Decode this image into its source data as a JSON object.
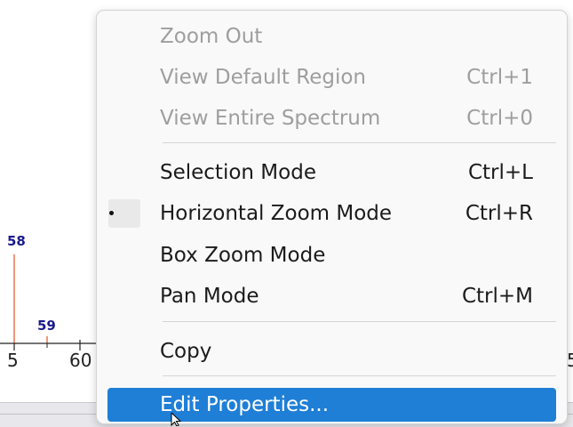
{
  "plot": {
    "peak_labels": [
      "58",
      "59"
    ],
    "tick_labels": [
      "5",
      "60"
    ],
    "edge_tick_label": "5",
    "peak_color": "#e8734a",
    "label_color": "#1a1a8c"
  },
  "menu": {
    "items": [
      {
        "label": "Zoom Out",
        "shortcut": "",
        "enabled": false
      },
      {
        "label": "View Default Region",
        "shortcut": "Ctrl+1",
        "enabled": false
      },
      {
        "label": "View Entire Spectrum",
        "shortcut": "Ctrl+0",
        "enabled": false
      },
      {
        "label": "Selection Mode",
        "shortcut": "Ctrl+L",
        "enabled": true
      },
      {
        "label": "Horizontal Zoom Mode",
        "shortcut": "Ctrl+R",
        "enabled": true,
        "checked": true
      },
      {
        "label": "Box Zoom Mode",
        "shortcut": "",
        "enabled": true
      },
      {
        "label": "Pan Mode",
        "shortcut": "Ctrl+M",
        "enabled": true
      },
      {
        "label": "Copy",
        "shortcut": "",
        "enabled": true
      },
      {
        "label": "Edit Properties...",
        "shortcut": "",
        "enabled": true,
        "highlighted": true
      }
    ],
    "highlight_color": "#1f7fd6",
    "disabled_color": "#9e9e9e"
  }
}
